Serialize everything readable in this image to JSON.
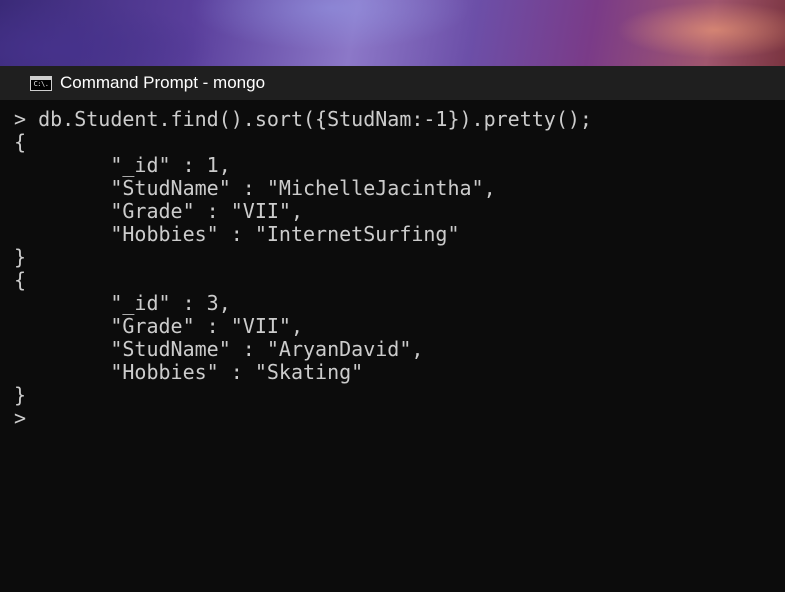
{
  "window": {
    "title": "Command Prompt - mongo",
    "icon": "cmd-icon",
    "icon_text": "C:\\."
  },
  "console": {
    "lines": [
      "> db.Student.find().sort({StudNam:-1}).pretty();",
      "{",
      "        \"_id\" : 1,",
      "        \"StudName\" : \"MichelleJacintha\",",
      "        \"Grade\" : \"VII\",",
      "        \"Hobbies\" : \"InternetSurfing\"",
      "}",
      "{",
      "        \"_id\" : 3,",
      "        \"Grade\" : \"VII\",",
      "        \"StudName\" : \"AryanDavid\",",
      "        \"Hobbies\" : \"Skating\"",
      "}",
      ">"
    ]
  },
  "colors": {
    "console_bg": "#0c0c0c",
    "console_text": "#cccccc",
    "titlebar_bg": "#1f1f1f",
    "title_text": "#ffffff"
  }
}
